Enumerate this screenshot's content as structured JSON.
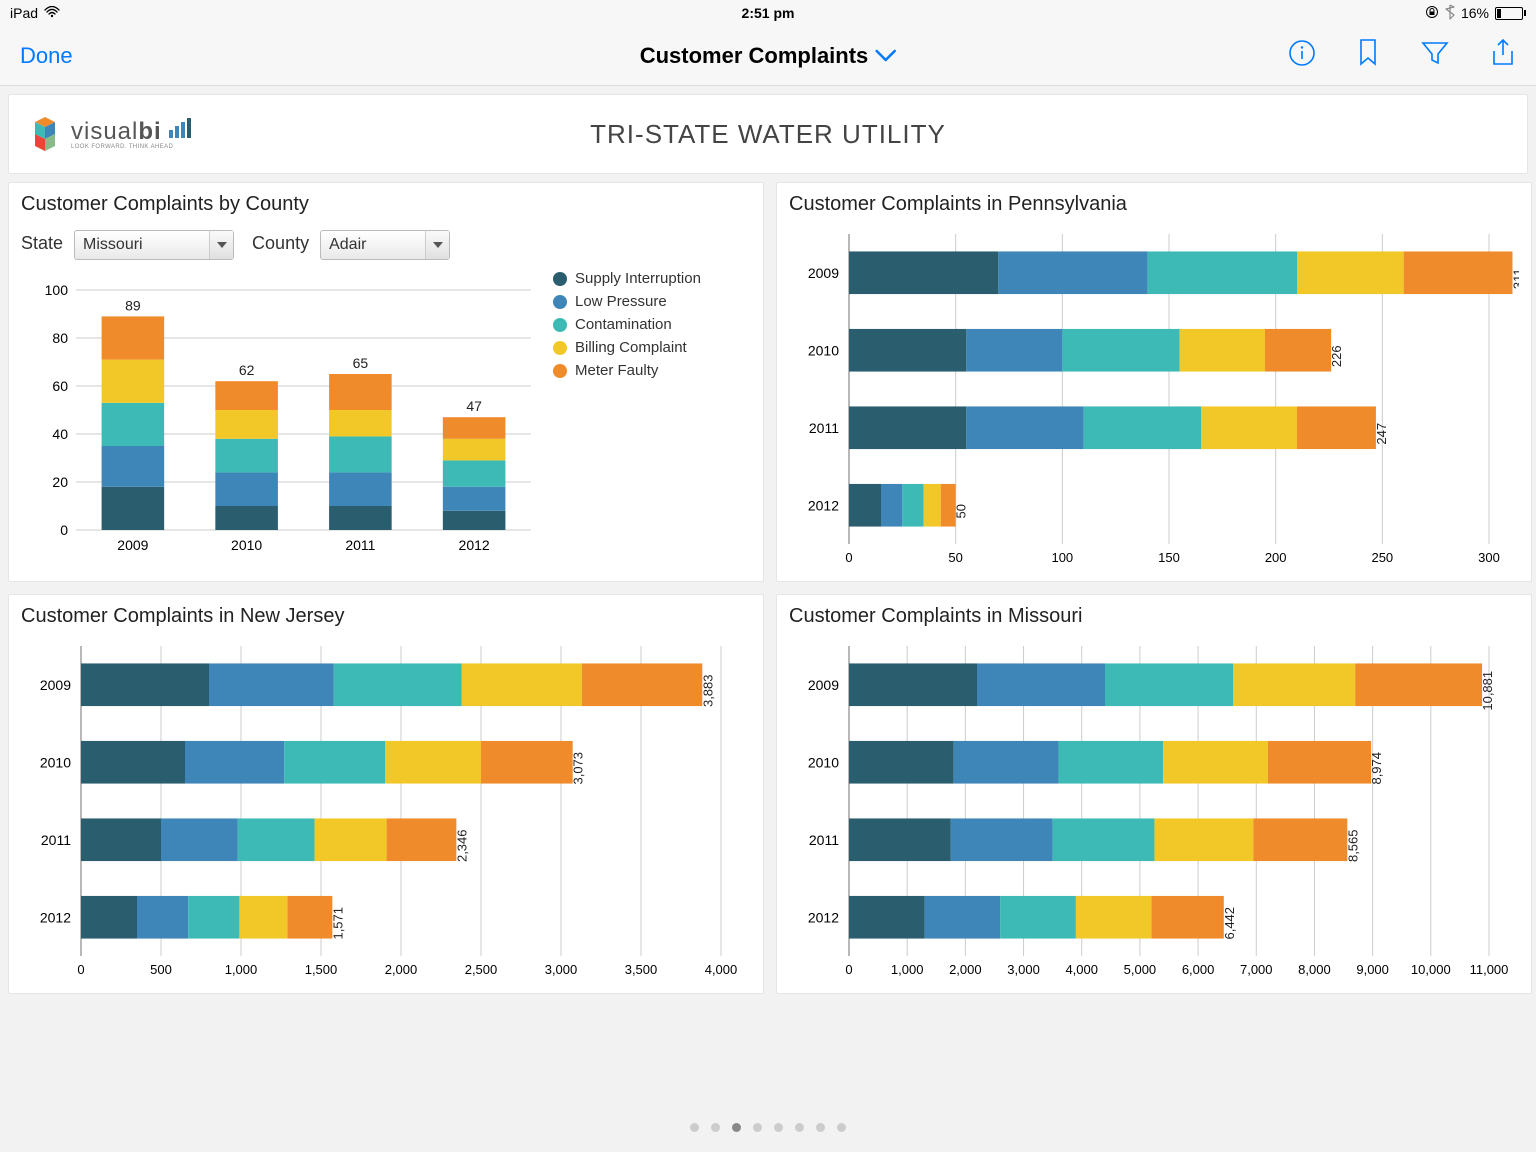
{
  "status": {
    "device": "iPad",
    "time": "2:51 pm",
    "battery_pct": "16%"
  },
  "nav": {
    "done": "Done",
    "title": "Customer Complaints"
  },
  "header": {
    "brand": "visual",
    "brand_bold": "bi",
    "brand_sub": "LOOK FORWARD. THINK AHEAD",
    "company": "TRI-STATE WATER UTILITY"
  },
  "legend": {
    "items": [
      "Supply Interruption",
      "Low Pressure",
      "Contamination",
      "Billing Complaint",
      "Meter Faulty"
    ],
    "colors": [
      "#2a5d6e",
      "#3f86b8",
      "#3dbab5",
      "#f2c828",
      "#f08b2c"
    ]
  },
  "filters": {
    "state_label": "State",
    "state_value": "Missouri",
    "county_label": "County",
    "county_value": "Adair"
  },
  "panels": {
    "county_title": "Customer Complaints by County",
    "pa_title": "Customer Complaints in Pennsylvania",
    "nj_title": "Customer Complaints in New Jersey",
    "mo_title": "Customer Complaints in Missouri"
  },
  "chart_data": [
    {
      "id": "county",
      "type": "bar",
      "orientation": "vertical",
      "title": "Customer Complaints by County",
      "categories": [
        "2009",
        "2010",
        "2011",
        "2012"
      ],
      "series": [
        {
          "name": "Supply Interruption",
          "values": [
            18,
            10,
            10,
            8
          ]
        },
        {
          "name": "Low Pressure",
          "values": [
            17,
            14,
            14,
            10
          ]
        },
        {
          "name": "Contamination",
          "values": [
            18,
            14,
            15,
            11
          ]
        },
        {
          "name": "Billing Complaint",
          "values": [
            18,
            12,
            11,
            9
          ]
        },
        {
          "name": "Meter Faulty",
          "values": [
            18,
            12,
            15,
            9
          ]
        }
      ],
      "totals": [
        89,
        62,
        65,
        47
      ],
      "ylim": [
        0,
        100
      ],
      "yticks": [
        0,
        20,
        40,
        60,
        80,
        100
      ]
    },
    {
      "id": "pa",
      "type": "bar",
      "orientation": "horizontal",
      "title": "Customer Complaints in Pennsylvania",
      "categories": [
        "2009",
        "2010",
        "2011",
        "2012"
      ],
      "series": [
        {
          "name": "Supply Interruption",
          "values": [
            70,
            55,
            55,
            15
          ]
        },
        {
          "name": "Low Pressure",
          "values": [
            70,
            45,
            55,
            10
          ]
        },
        {
          "name": "Contamination",
          "values": [
            70,
            55,
            55,
            10
          ]
        },
        {
          "name": "Billing Complaint",
          "values": [
            50,
            40,
            45,
            8
          ]
        },
        {
          "name": "Meter Faulty",
          "values": [
            51,
            31,
            37,
            7
          ]
        }
      ],
      "totals": [
        311,
        226,
        247,
        50
      ],
      "xlim": [
        0,
        300
      ],
      "xticks": [
        0,
        50,
        100,
        150,
        200,
        250,
        300
      ]
    },
    {
      "id": "nj",
      "type": "bar",
      "orientation": "horizontal",
      "title": "Customer Complaints in New Jersey",
      "categories": [
        "2009",
        "2010",
        "2011",
        "2012"
      ],
      "series": [
        {
          "name": "Supply Interruption",
          "values": [
            800,
            650,
            500,
            350
          ]
        },
        {
          "name": "Low Pressure",
          "values": [
            780,
            620,
            480,
            320
          ]
        },
        {
          "name": "Contamination",
          "values": [
            800,
            630,
            480,
            320
          ]
        },
        {
          "name": "Billing Complaint",
          "values": [
            750,
            600,
            450,
            300
          ]
        },
        {
          "name": "Meter Faulty",
          "values": [
            753,
            573,
            436,
            281
          ]
        }
      ],
      "totals": [
        3883,
        3073,
        2346,
        1571
      ],
      "xlim": [
        0,
        4000
      ],
      "xticks": [
        0,
        500,
        1000,
        1500,
        2000,
        2500,
        3000,
        3500,
        4000
      ]
    },
    {
      "id": "mo",
      "type": "bar",
      "orientation": "horizontal",
      "title": "Customer Complaints in Missouri",
      "categories": [
        "2009",
        "2010",
        "2011",
        "2012"
      ],
      "series": [
        {
          "name": "Supply Interruption",
          "values": [
            2200,
            1800,
            1750,
            1300
          ]
        },
        {
          "name": "Low Pressure",
          "values": [
            2200,
            1800,
            1750,
            1300
          ]
        },
        {
          "name": "Contamination",
          "values": [
            2200,
            1800,
            1750,
            1300
          ]
        },
        {
          "name": "Billing Complaint",
          "values": [
            2100,
            1800,
            1700,
            1300
          ]
        },
        {
          "name": "Meter Faulty",
          "values": [
            2181,
            1774,
            1615,
            1242
          ]
        }
      ],
      "totals": [
        10881,
        8974,
        8565,
        6442
      ],
      "xlim": [
        0,
        11000
      ],
      "xticks": [
        0,
        1000,
        2000,
        3000,
        4000,
        5000,
        6000,
        7000,
        8000,
        9000,
        10000,
        11000
      ]
    }
  ],
  "pager": {
    "count": 8,
    "active": 3
  }
}
